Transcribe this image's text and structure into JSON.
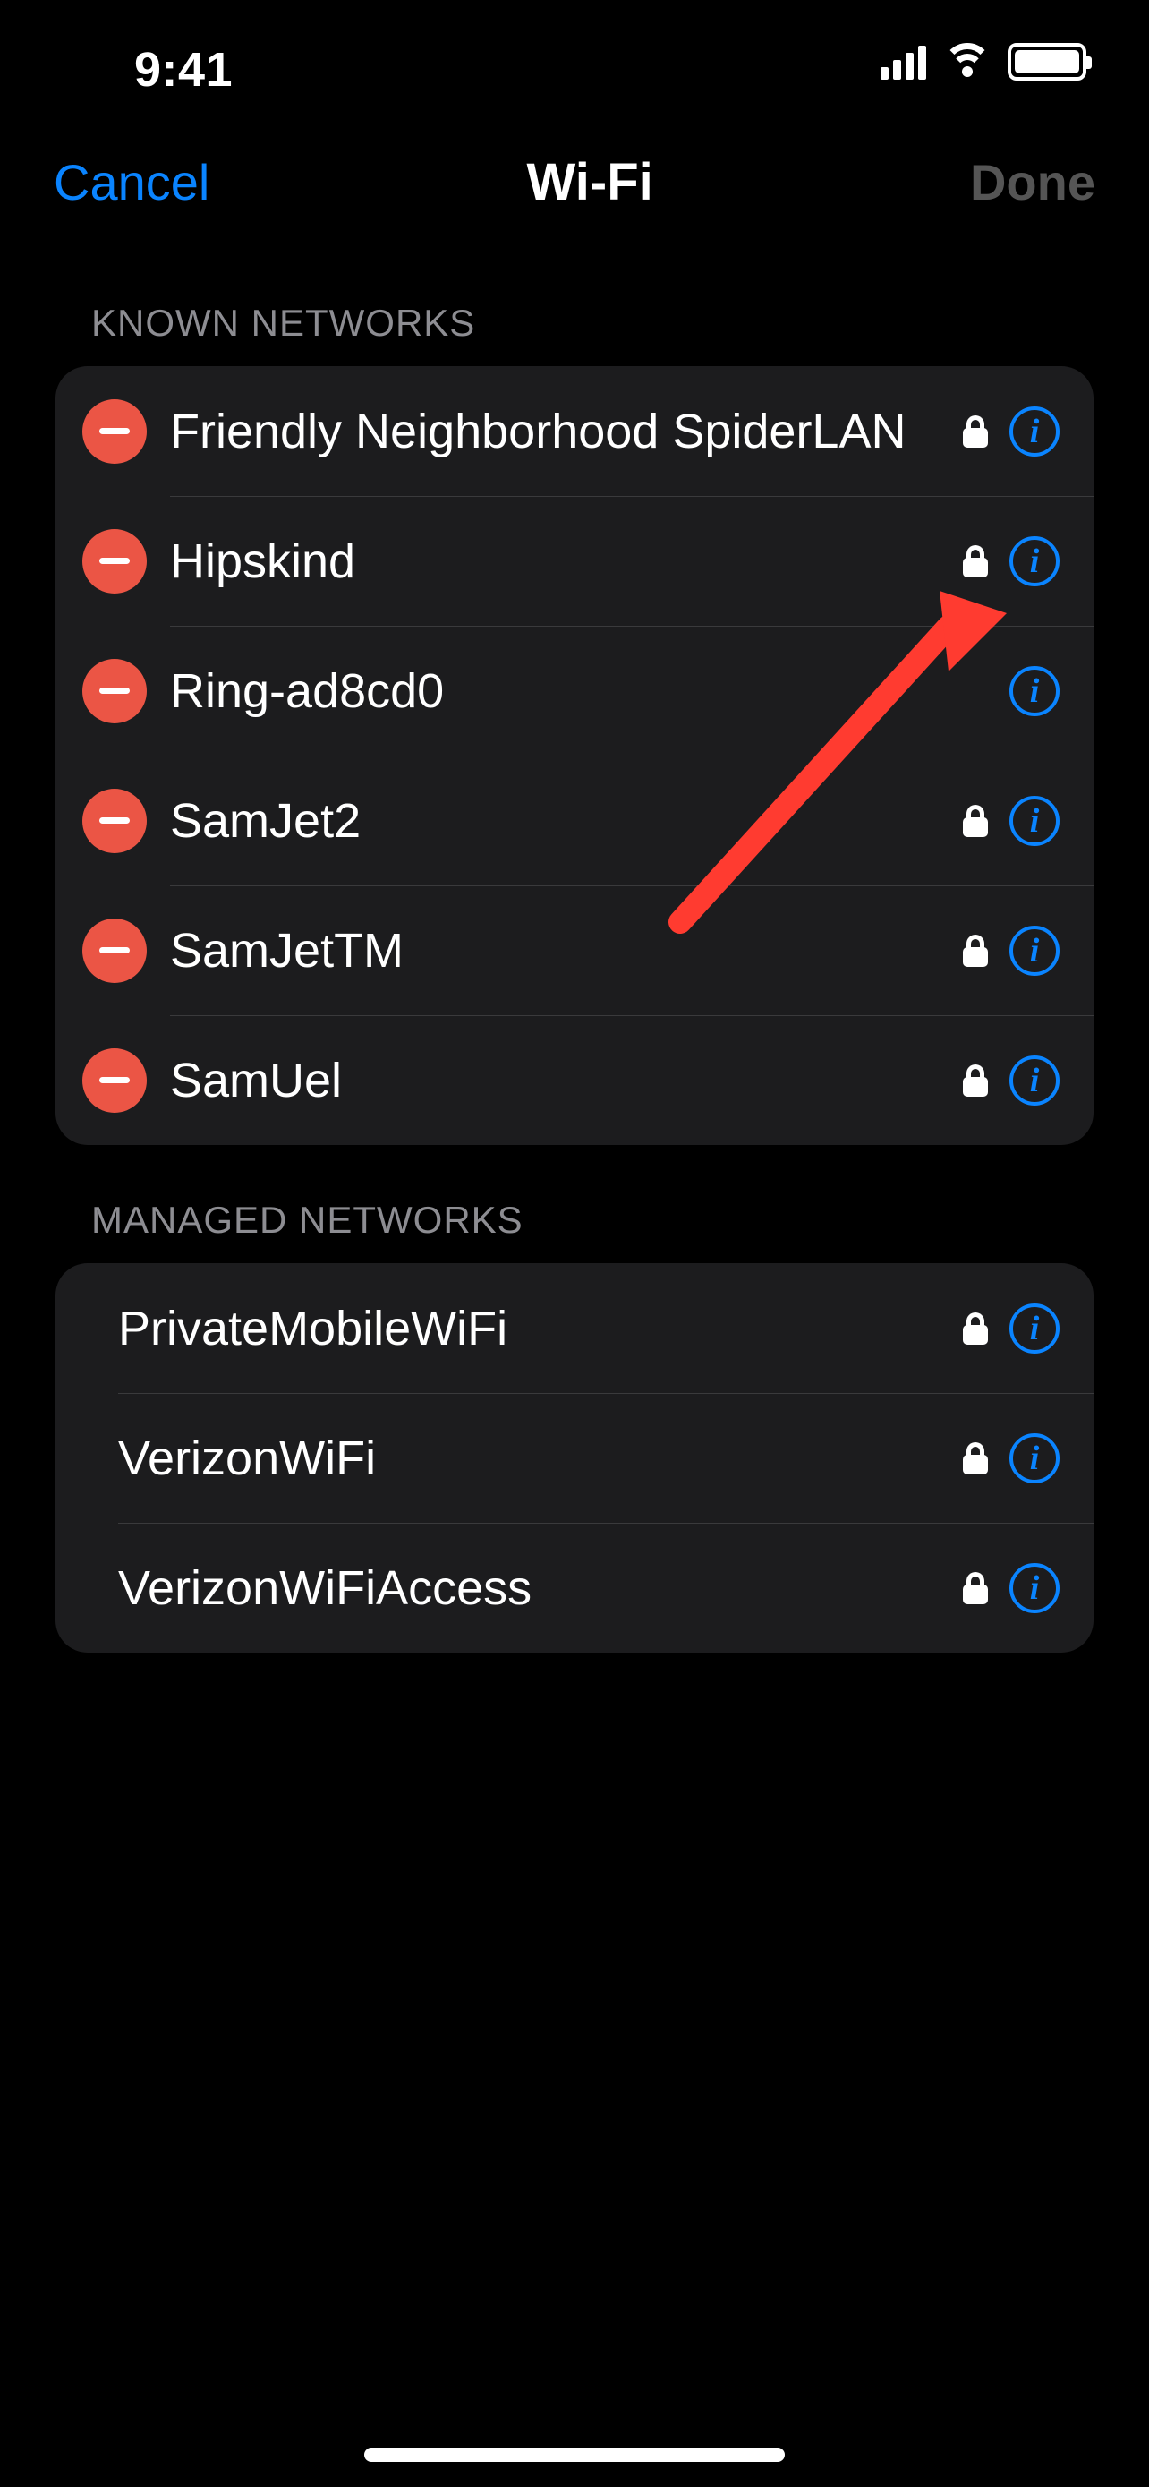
{
  "status": {
    "time": "9:41"
  },
  "nav": {
    "cancel": "Cancel",
    "title": "Wi-Fi",
    "done": "Done"
  },
  "sections": {
    "known": {
      "header": "KNOWN NETWORKS",
      "items": [
        {
          "name": "Friendly Neighborhood SpiderLAN",
          "locked": true
        },
        {
          "name": "Hipskind",
          "locked": true
        },
        {
          "name": "Ring-ad8cd0",
          "locked": false
        },
        {
          "name": "SamJet2",
          "locked": true
        },
        {
          "name": "SamJetTM",
          "locked": true
        },
        {
          "name": "SamUel",
          "locked": true
        }
      ]
    },
    "managed": {
      "header": "MANAGED NETWORKS",
      "items": [
        {
          "name": "PrivateMobileWiFi",
          "locked": true
        },
        {
          "name": "VerizonWiFi",
          "locked": true
        },
        {
          "name": "VerizonWiFiAccess",
          "locked": true
        }
      ]
    }
  },
  "annotation": {
    "target": "info button of second known network (Hipskind)",
    "color": "#ff3b30"
  }
}
